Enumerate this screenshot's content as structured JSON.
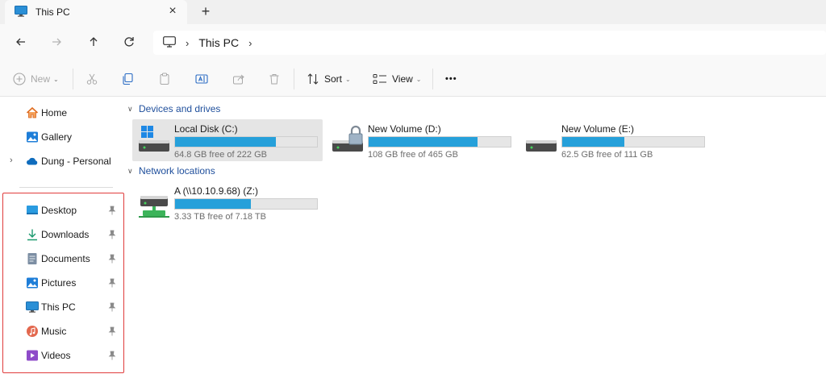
{
  "tab": {
    "title": "This PC",
    "close_icon": "close-icon",
    "new_tab_icon": "plus-icon"
  },
  "nav": {
    "back_icon": "arrow-left-icon",
    "forward_icon": "arrow-right-icon",
    "up_icon": "arrow-up-icon",
    "refresh_icon": "refresh-icon",
    "address": {
      "icon": "computer-icon",
      "path": "This PC"
    }
  },
  "toolbar": {
    "new_label": "New",
    "sort_label": "Sort",
    "view_label": "View",
    "more_label": "•••"
  },
  "sidebar": {
    "top_items": [
      {
        "label": "Home",
        "icon": "home-icon"
      },
      {
        "label": "Gallery",
        "icon": "gallery-icon"
      },
      {
        "label": "Dung - Personal",
        "icon": "cloud-icon",
        "expandable": true
      }
    ],
    "pinned_items": [
      {
        "label": "Desktop",
        "icon": "desktop-icon"
      },
      {
        "label": "Downloads",
        "icon": "download-icon"
      },
      {
        "label": "Documents",
        "icon": "document-icon"
      },
      {
        "label": "Pictures",
        "icon": "picture-icon"
      },
      {
        "label": "This PC",
        "icon": "computer-icon"
      },
      {
        "label": "Music",
        "icon": "music-icon"
      },
      {
        "label": "Videos",
        "icon": "video-icon"
      }
    ],
    "highlight_color": "#e03c3c"
  },
  "content": {
    "devices_header": "Devices and drives",
    "network_header": "Network locations",
    "drives": [
      {
        "name": "Local Disk (C:)",
        "free_text": "64.8 GB free of 222 GB",
        "used_fraction": 0.708,
        "selected": true,
        "icon": "windows-drive-icon"
      },
      {
        "name": "New Volume (D:)",
        "free_text": "108 GB free of 465 GB",
        "used_fraction": 0.768,
        "selected": false,
        "icon": "locked-drive-icon"
      },
      {
        "name": "New Volume (E:)",
        "free_text": "62.5 GB free of 111 GB",
        "used_fraction": 0.437,
        "selected": false,
        "icon": "drive-icon"
      }
    ],
    "network": [
      {
        "name": "A (\\\\10.10.9.68) (Z:)",
        "free_text": "3.33 TB free of 7.18 TB",
        "used_fraction": 0.536,
        "icon": "network-drive-icon"
      }
    ]
  },
  "colors": {
    "accent": "#26a0da",
    "section_text": "#1f4f9c",
    "selected_bg": "#e5e5e5"
  }
}
